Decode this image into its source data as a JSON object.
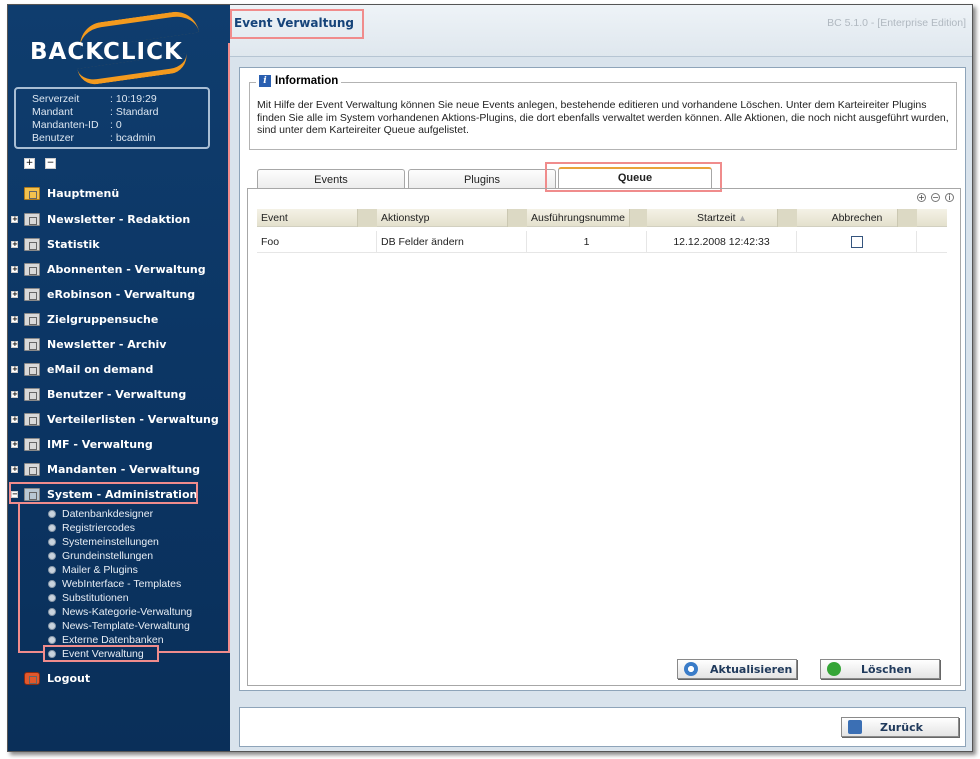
{
  "app": {
    "logo_text": "BACKCLICK",
    "version": "BC 5.1.0 - [Enterprise Edition]",
    "page_title": "Event Verwaltung"
  },
  "session": {
    "rows": [
      {
        "key": "Serverzeit",
        "value": ": 10:19:29"
      },
      {
        "key": "Mandant",
        "value": ": Standard"
      },
      {
        "key": "Mandanten-ID",
        "value": ": 0"
      },
      {
        "key": "Benutzer",
        "value": ": bcadmin"
      }
    ]
  },
  "tree_controls": {
    "expand": "+",
    "collapse": "−"
  },
  "nav": {
    "home": "Hauptmenü",
    "items": [
      "Newsletter - Redaktion",
      "Statistik",
      "Abonnenten - Verwaltung",
      "eRobinson - Verwaltung",
      "Zielgruppensuche",
      "Newsletter - Archiv",
      "eMail on demand",
      "Benutzer - Verwaltung",
      "Verteilerlisten - Verwaltung",
      "IMF - Verwaltung",
      "Mandanten - Verwaltung",
      "System - Administration"
    ],
    "sub_items": [
      "Datenbankdesigner",
      "Registriercodes",
      "Systemeinstellungen",
      "Grundeinstellungen",
      "Mailer & Plugins",
      "WebInterface - Templates",
      "Substitutionen",
      "News-Kategorie-Verwaltung",
      "News-Template-Verwaltung",
      "Externe Datenbanken",
      "Event Verwaltung"
    ],
    "logout": "Logout"
  },
  "info": {
    "title": "Information",
    "text": "Mit Hilfe der Event Verwaltung können Sie neue Events anlegen, bestehende editieren und vorhandene Löschen. Unter dem Karteireiter Plugins finden Sie alle im System vorhandenen Aktions-Plugins, die dort ebenfalls verwaltet werden können. Alle Aktionen, die noch nicht ausgeführt wurden, sind unter dem Karteireiter Queue aufgelistet."
  },
  "tabs": [
    "Events",
    "Plugins",
    "Queue"
  ],
  "active_tab": "Queue",
  "grid": {
    "columns": [
      "Event",
      "Aktionstyp",
      "Ausführungsnumme",
      "Startzeit",
      "Abbrechen"
    ],
    "rows": [
      {
        "event": "Foo",
        "aktionstyp": "DB Felder ändern",
        "nummer": "1",
        "startzeit": "12.12.2008 12:42:33",
        "abbrechen": false
      }
    ]
  },
  "buttons": {
    "refresh": "Aktualisieren",
    "delete": "Löschen",
    "back": "Zurück"
  },
  "colors": {
    "sidebar": "#0b3462",
    "accent": "#f39a1e",
    "highlight": "#f08c8c",
    "title": "#16447a"
  }
}
